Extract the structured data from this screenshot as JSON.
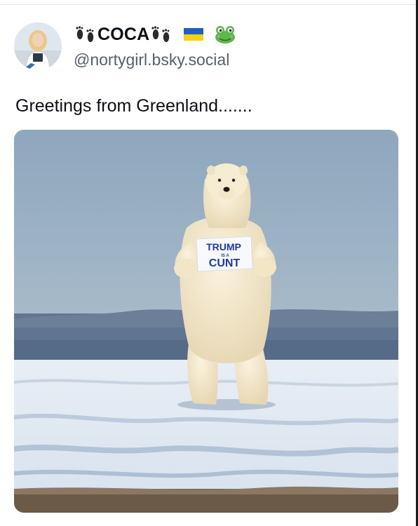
{
  "post": {
    "author": {
      "display_name": "COCA",
      "handle": "@nortygirl.bsky.social",
      "name_decorations": [
        "footprints-emoji",
        "footprints-emoji",
        "ukraine-flag-emoji",
        "frog-emoji"
      ]
    },
    "text": "Greetings from Greenland.......",
    "image": {
      "sign_text": {
        "line1": "TRUMP",
        "line2": "IS A",
        "line3": "CUNT"
      }
    }
  },
  "colors": {
    "text_primary": "#0b0f14",
    "text_secondary": "#54606e",
    "sky": "#8fa8bd",
    "ice": "#eef3f8",
    "flag_blue": "#1f5fbf",
    "flag_yellow": "#f5cf1a",
    "frog_green": "#5cb84a"
  }
}
